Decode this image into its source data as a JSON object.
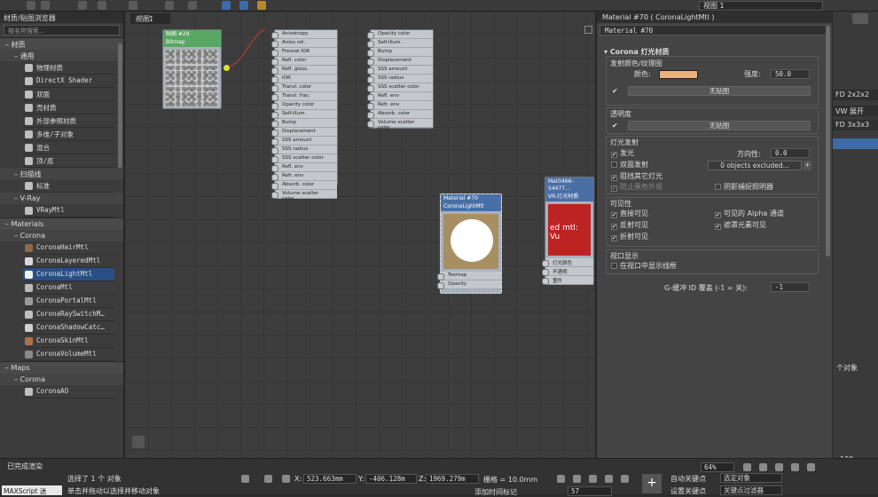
{
  "panels": {
    "left_title": "材质/贴图浏览器",
    "search_placeholder": "按名称搜索...",
    "canvas_tab": "视图1",
    "top_viewport": "视图 1"
  },
  "browser": {
    "cat_materials_cn": "材质",
    "sub_general": "通用",
    "general_items": [
      "物理材质",
      "DirectX Shader",
      "双面",
      "壳材质",
      "外部参照材质",
      "多维/子对象",
      "混合",
      "顶/底"
    ],
    "sub_scanline": "扫描线",
    "scanline_items": [
      "标准"
    ],
    "sub_vray": "V-Ray",
    "vray_items": [
      "VRayMtl"
    ],
    "cat_materials": "Materials",
    "sub_corona": "Corona",
    "corona_items": [
      "CoronaHairMtl",
      "CoronaLayeredMtl",
      "CoronaLightMtl",
      "CoronaMtl",
      "CoronaPortalMtl",
      "CoronaRaySwitchM…",
      "CoronaShadowCatc…",
      "CoronaSkinMtl",
      "CoronaVolumeMtl"
    ],
    "cat_maps": "Maps",
    "sub_corona_maps": "Corona",
    "map_items": [
      "CoronaAO"
    ]
  },
  "nodes": {
    "bitmap": {
      "title": "贴图 #29",
      "subtitle": "Bitmap"
    },
    "mtl_a_slots": [
      "Anisotropy",
      "Aniso rot.",
      "Fresnel IOR",
      "Refl. color",
      "Refl. gloss.",
      "IOR",
      "Transl. color",
      "Transl. frac.",
      "Opacity color",
      "Self-illum.",
      "Bump",
      "Displacement",
      "SSS amount",
      "SSS radius",
      "SSS scatter color",
      "Refl. env",
      "Refr. env",
      "Absorb. color",
      "Volume scatter color"
    ],
    "mtl_b_slots": [
      "Opacity color",
      "Self-illum.",
      "Bump",
      "Displacement",
      "SSS amount",
      "SSS radius",
      "SSS scatter color",
      "Refl. env",
      "Refr. env",
      "Absorb. color",
      "Volume scatter color"
    ],
    "light": {
      "title": "Material #70",
      "subtitle": "CoronaLightMtl",
      "slots": [
        "Texmap",
        "Opacity"
      ]
    },
    "vray": {
      "title": "Mat0466-54477…",
      "subtitle": "VR-灯光材质",
      "slots": [
        "灯光颜色",
        "不透明",
        "置件"
      ],
      "preview_text": "ed mtl: Vu"
    }
  },
  "props": {
    "title": "Material #70 ( CoronaLightMtl )",
    "name": "Material #70",
    "rollout": "Corona 灯光材质",
    "emit_group": "发射颜色/纹理图",
    "color_label": "颜色:",
    "color_value": "#e8b07c",
    "intensity_label": "强度:",
    "intensity": "50.0",
    "no_map_1": "无贴图",
    "opacity_group": "透明度",
    "no_map_2": "无贴图",
    "light_group": "灯光发射",
    "emit_light": "发光",
    "directionality_label": "方向性:",
    "directionality": "0.0",
    "two_sided": "双面发射",
    "objects_excluded": "0 objects excluded...",
    "occlude_other": "阻挡其它灯光",
    "prevent_blown": "防止黑色外观",
    "shadow_catcher": "阴影捕捉照明器",
    "vis_group": "可见性",
    "vis_direct": "直接可见",
    "vis_alpha": "可见的 Alpha 通道",
    "vis_refl": "反射可见",
    "vis_mask": "遮罩元素可见",
    "vis_refr": "折射可见",
    "viewport_group": "视口显示",
    "viewport_wire": "在视口中显示线框",
    "gbuffer_label": "G-缓冲 ID 覆盖 (-1 = 关):",
    "gbuffer": "-1"
  },
  "far_right": [
    "FD 2x2x2",
    "VW 展开",
    "FD 3x3x3",
    "个对象",
    "100"
  ],
  "status": {
    "render_done": "已完成渲染",
    "script": "MAXScript 迷",
    "selected": "选择了 1 个 对象",
    "hint": "单击并拖动以选择并移动对象",
    "x_label": "X:",
    "x": "523.663mm",
    "y_label": "Y:",
    "y": "-406.128m",
    "z_label": "Z:",
    "z": "1969.279m",
    "grid": "栅格 = 10.0mm",
    "add_time_tag": "添加时间标记",
    "auto_key": "自动关键点",
    "selected_objects": "选定对象",
    "set_key": "设置关键点",
    "key_filter": "关键点过滤器",
    "zoom": "64%",
    "frame": "57"
  },
  "colors": {
    "accent_select": "#2a4f86",
    "node_header": "#58a863"
  }
}
